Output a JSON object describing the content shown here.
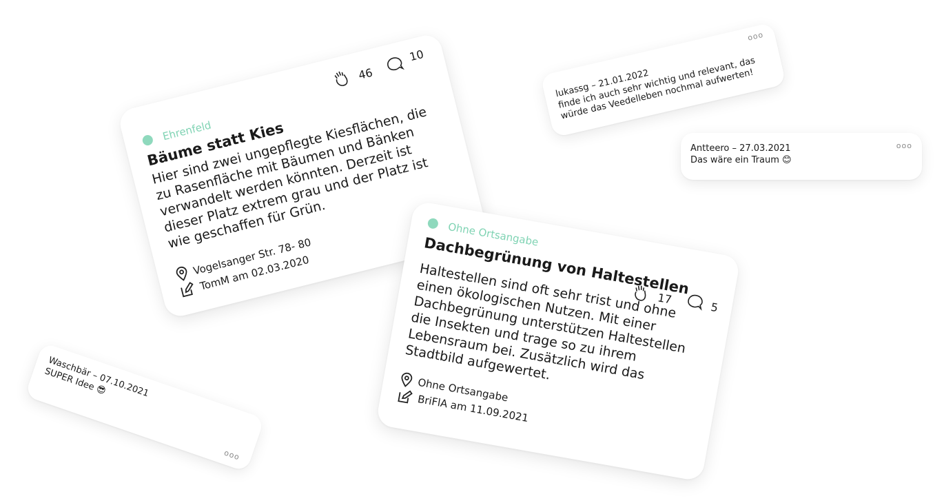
{
  "ideas": [
    {
      "district": "Ehrenfeld",
      "title": "Bäume statt Kies",
      "description": "Hier sind zwei ungepflegte Kiesflächen, die zu Rasenfläche mit Bäumen und Bänken verwandelt werden könnten. Derzeit ist dieser Platz extrem grau und der Platz ist wie geschaffen für Grün.",
      "applause_count": "46",
      "comment_count": "10",
      "location": "Vogelsanger Str. 78- 80",
      "author_line": "TomM am 02.03.2020"
    },
    {
      "district": "Ohne Ortsangabe",
      "title": "Dachbegrünung von Haltestellen",
      "description": "Haltestellen sind oft sehr trist und ohne einen ökologischen Nutzen. Mit einer Dachbegrünung unterstützen Haltestellen die Insekten und trage so zu ihrem Lebensraum bei. Zusätzlich wird das Stadtbild aufgewertet.",
      "applause_count": "17",
      "comment_count": "5",
      "location": "Ohne Ortsangabe",
      "author_line": "BriFlA am 11.09.2021"
    }
  ],
  "comments": [
    {
      "author": "lukassg – 21.01.2022",
      "text": "finde ich auch sehr wichtig und relevant, das würde das Veedelleben nochmal aufwerten!",
      "more": "ooo"
    },
    {
      "author": "Antteero – 27.03.2021",
      "text": "Das wäre ein Traum 😊",
      "more": "ooo"
    },
    {
      "author": "Waschbär – 07.10.2021",
      "text": "SUPER Idee 😎",
      "more": "ooo"
    }
  ],
  "colors": {
    "accent": "#8fd9bd",
    "text": "#1a1a1a",
    "background": "#ffffff"
  },
  "icons": {
    "applause": "clapping-hands-icon",
    "comments": "speech-bubble-icon",
    "location": "map-pin-icon",
    "author": "edit-icon"
  }
}
